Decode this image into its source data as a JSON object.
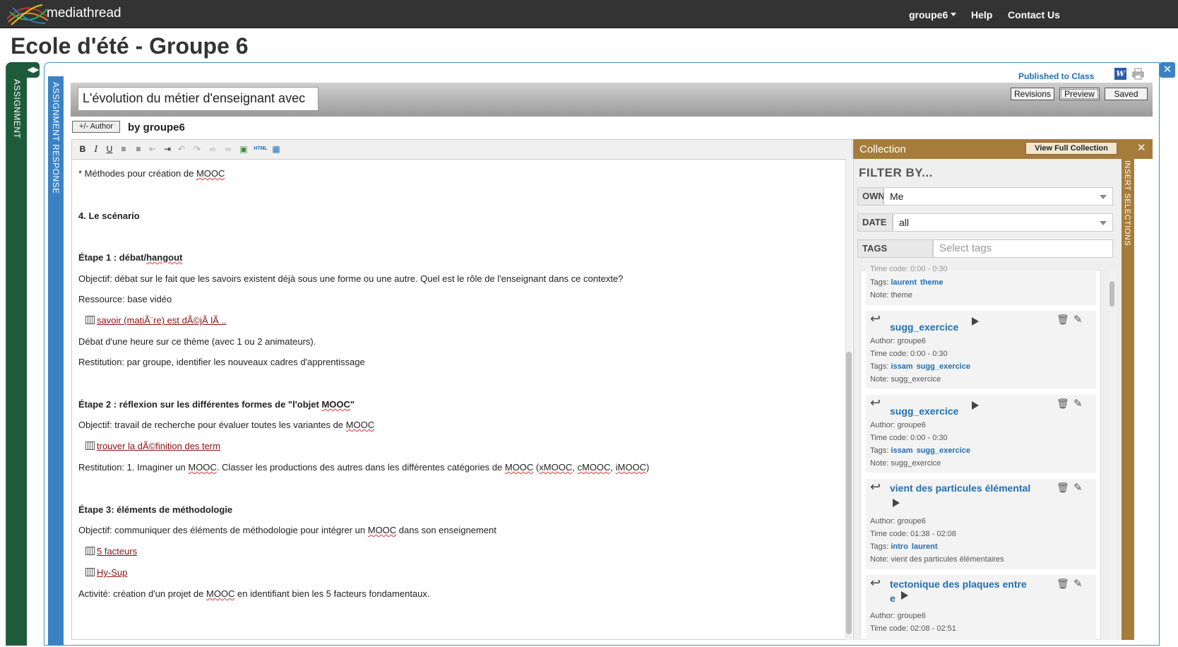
{
  "navbar": {
    "brand": "mediathread",
    "user_menu": "groupe6",
    "help": "Help",
    "contact": "Contact Us"
  },
  "page_title": "Ecole d'été - Groupe 6",
  "tabs": {
    "assignment": "ASSIGNMENT",
    "response": "ASSIGNMENT RESPONSE",
    "insert": "INSERT SELECTIONS"
  },
  "status": {
    "published": "Published to Class",
    "revisions": "Revisions",
    "preview": "Preview",
    "saved": "Saved"
  },
  "doc": {
    "title": "L'évolution du métier d'enseignant avec",
    "author_button": "+/- Author",
    "byline": "by groupe6"
  },
  "editor": {
    "lines": [
      "* Méthodes pour création de MOOC",
      "4. Le scénario",
      "Étape 1 : débat/hangout",
      "Objectif: débat sur le fait que les savoirs existent déjà sous une forme ou une autre. Quel est le rôle de l'enseignant dans ce contexte?",
      "Ressource: base vidéo",
      "savoir (matiÃ¨re) est dÃ©jÃ  lÃ ..",
      "Débat d'une heure sur ce thème (avec 1 ou 2 animateurs).",
      "Restitution: par groupe, identifier les nouveaux cadres d'apprentissage",
      "Étape 2 : réflexion sur les différentes formes de \"l'objet MOOC\"",
      "Objectif: travail de recherche pour évaluer toutes les variantes de MOOC",
      "trouver la dÃ©finition des term",
      "Restitution: 1. Imaginer un MOOC. Classer les productions des autres dans les différentes catégories de MOOC (xMOOC, cMOOC, iMOOC)",
      "Étape 3: éléments de méthodologie",
      "Objectif: communiquer des éléments de méthodologie pour intégrer un MOOC dans son enseignement",
      "5 facteurs",
      "Hy-Sup",
      "Activité: création d'un projet de MOOC en identifiant bien les 5 facteurs fondamentaux."
    ]
  },
  "collection": {
    "title": "Collection",
    "view_full": "View Full Collection",
    "filter_by": "FILTER BY...",
    "owner_label": "OWNER",
    "owner_value": "Me",
    "date_label": "DATE",
    "date_value": "all",
    "tags_label": "TAGS",
    "tags_placeholder": "Select tags",
    "partial": {
      "timecode": "Time code: 0:00 - 0:30",
      "tags_prefix": "Tags:",
      "tag1": "laurent",
      "tag2": "theme",
      "note": "Note: theme"
    },
    "items": [
      {
        "title": "sugg_exercice",
        "author": "Author: groupe6",
        "timecode": "Time code: 0:00 - 0:30",
        "tags_prefix": "Tags:",
        "tag1": "issam",
        "tag2": "sugg_exercice",
        "note": "Note: sugg_exercice"
      },
      {
        "title": "sugg_exercice",
        "author": "Author: groupe6",
        "timecode": "Time code: 0:00 - 0:30",
        "tags_prefix": "Tags:",
        "tag1": "issam",
        "tag2": "sugg_exercice",
        "note": "Note: sugg_exercice"
      },
      {
        "title": "vient des particules élémental",
        "author": "Author: groupe6",
        "timecode": "Time code: 01:38 - 02:08",
        "tags_prefix": "Tags:",
        "tag1": "intro",
        "tag2": "laurent",
        "note": "Note: vient des particules élémentaires"
      },
      {
        "title_line1": "tectonique des plaques entre",
        "title_line2": "e",
        "author": "Author: groupe6",
        "timecode": "Time code: 02:08 - 02:51"
      }
    ]
  },
  "colors": {
    "navbar": "#333333",
    "assignment_tab": "#1e5b3b",
    "response_tab": "#3b82c4",
    "collection": "#a67c3b",
    "link": "#1f6fb4"
  }
}
